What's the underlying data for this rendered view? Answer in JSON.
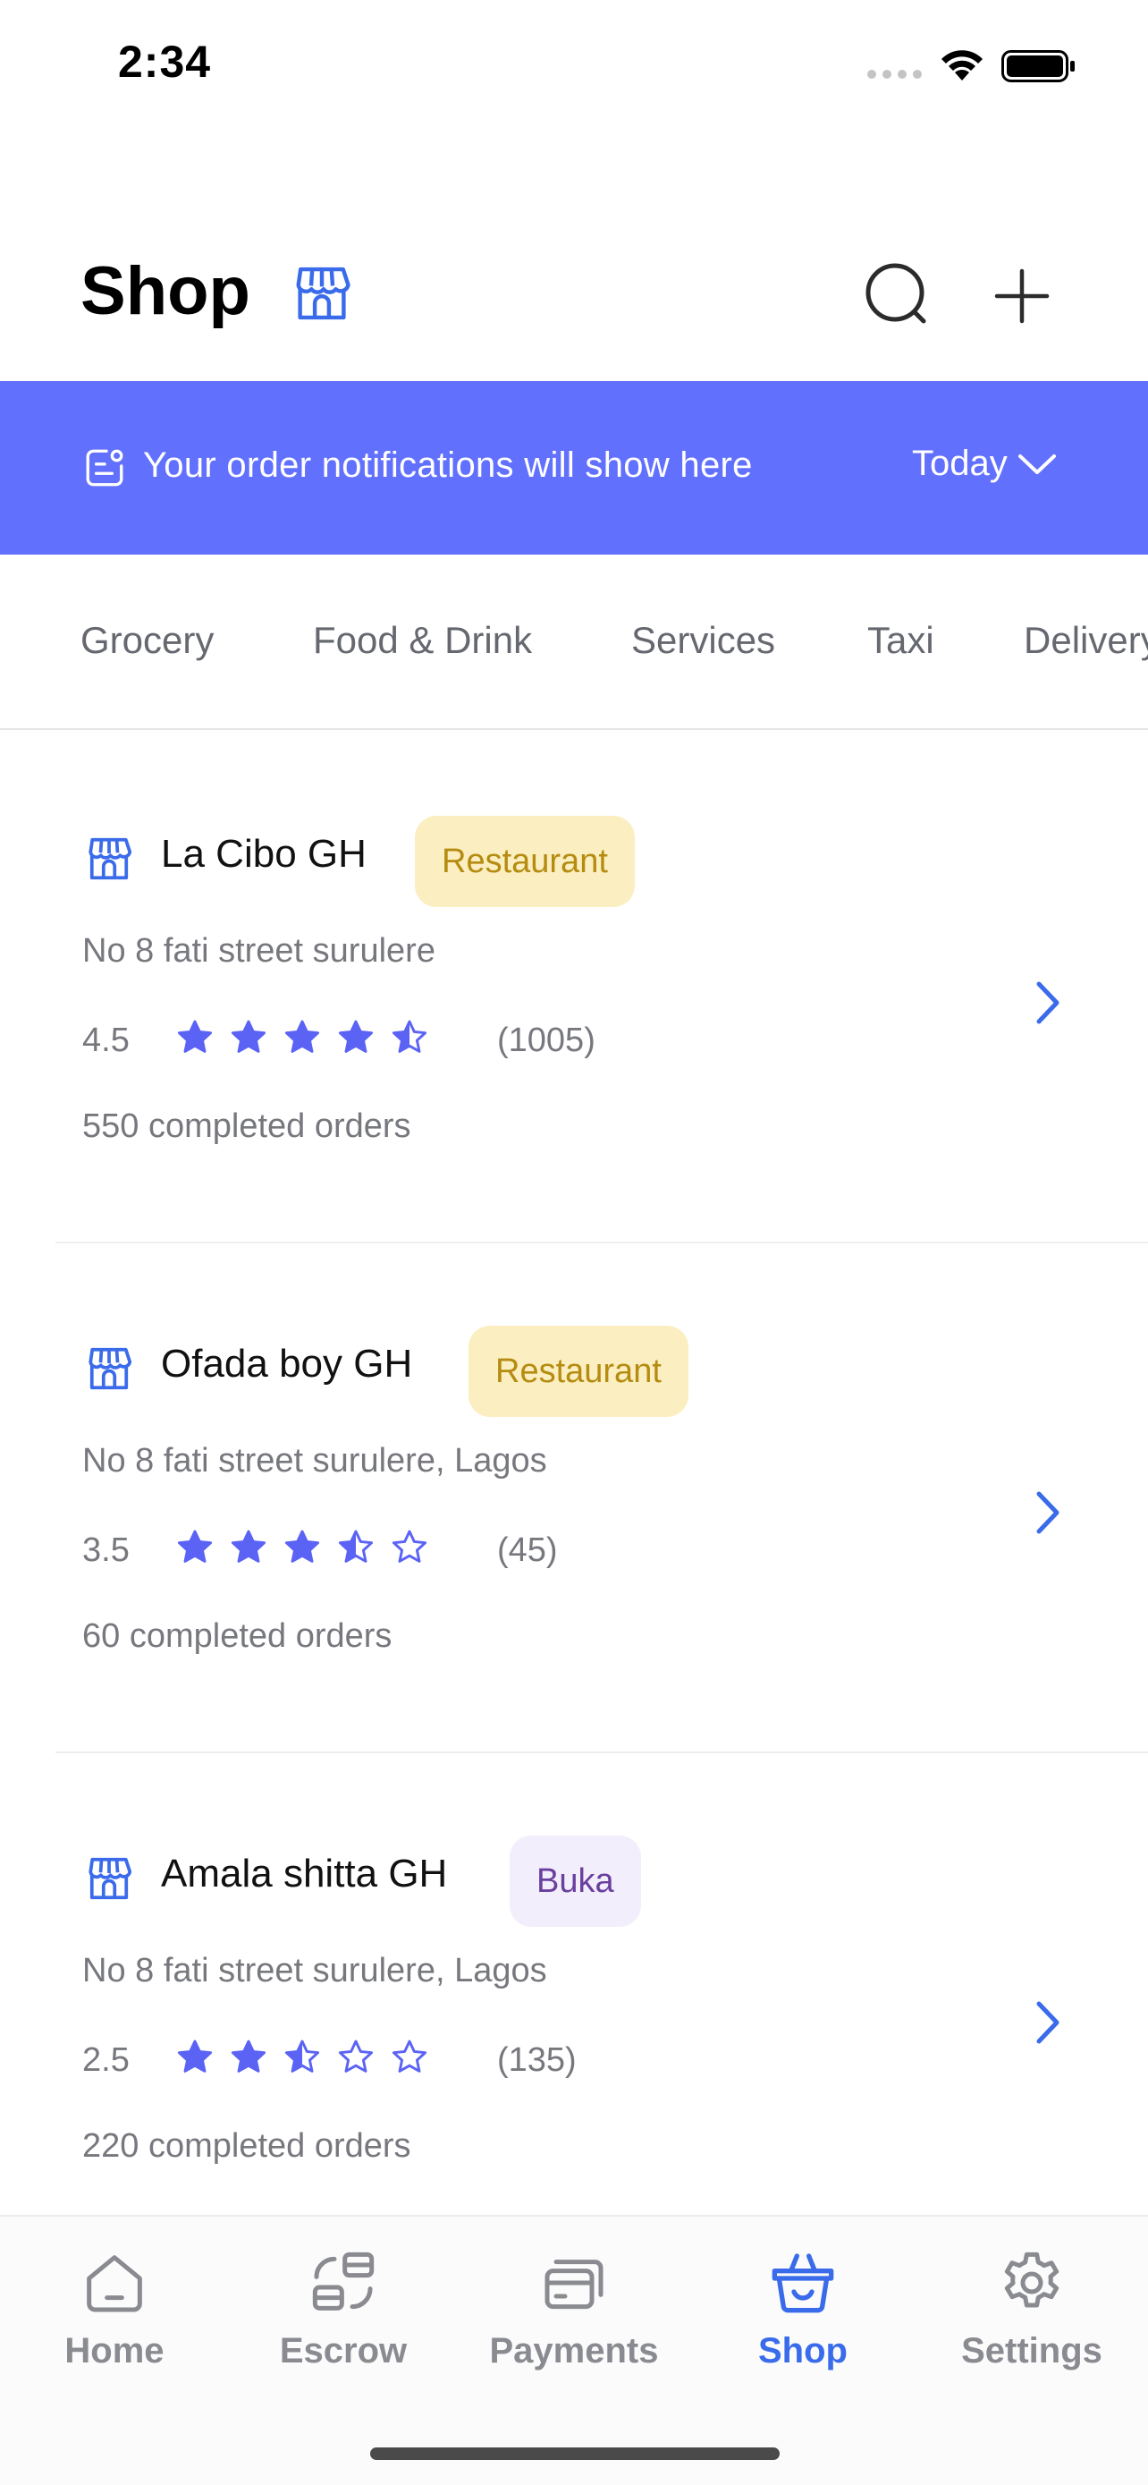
{
  "status_bar": {
    "time": "2:34"
  },
  "header": {
    "title": "Shop"
  },
  "notification": {
    "text": "Your order notifications will show here",
    "filter_label": "Today"
  },
  "categories": [
    "Grocery",
    "Food & Drink",
    "Services",
    "Taxi",
    "Delivery"
  ],
  "shops": [
    {
      "name": "La Cibo GH",
      "tag": "Restaurant",
      "address": "No 8 fati street surulere",
      "rating": "4.5",
      "rating_value": 4.5,
      "reviews": "(1005)",
      "orders": "550 completed orders"
    },
    {
      "name": "Ofada boy GH",
      "tag": "Restaurant",
      "address": "No 8 fati street surulere, Lagos",
      "rating": "3.5",
      "rating_value": 3.5,
      "reviews": "(45)",
      "orders": "60 completed orders"
    },
    {
      "name": "Amala shitta GH",
      "tag": "Buka",
      "address": "No 8 fati street surulere, Lagos",
      "rating": "2.5",
      "rating_value": 2.5,
      "reviews": "(135)",
      "orders": "220 completed orders"
    }
  ],
  "bottom_nav": [
    {
      "label": "Home",
      "icon": "home-icon",
      "active": false
    },
    {
      "label": "Escrow",
      "icon": "escrow-icon",
      "active": false
    },
    {
      "label": "Payments",
      "icon": "payments-icon",
      "active": false
    },
    {
      "label": "Shop",
      "icon": "shop-basket-icon",
      "active": true
    },
    {
      "label": "Settings",
      "icon": "gear-icon",
      "active": false
    }
  ],
  "colors": {
    "accent": "#6271fd",
    "star": "#5b63f5",
    "active_nav": "#3a6bea",
    "chevron": "#3a6bea",
    "restaurant_tag_bg": "#fbeec1",
    "restaurant_tag_text": "#b58c10",
    "buka_tag_bg": "#f2eefb",
    "buka_tag_text": "#6a3f9e"
  }
}
